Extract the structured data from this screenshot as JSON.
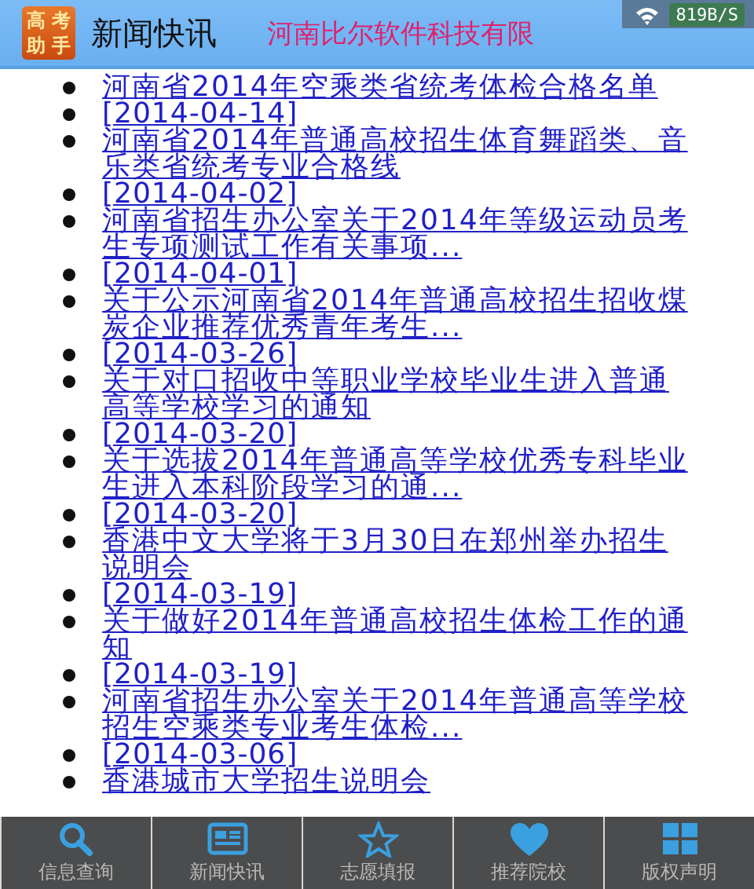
{
  "status_bar": {
    "net_speed": "819B/S"
  },
  "header": {
    "logo_text": "高考助手",
    "title": "新闻快讯",
    "marquee": "河南比尔软件科技有限"
  },
  "news": [
    {
      "kind": "title",
      "text": "河南省2014年空乘类省统考体检合格名单"
    },
    {
      "kind": "date",
      "text": "[2014-04-14]"
    },
    {
      "kind": "title",
      "text": "河南省2014年普通高校招生体育舞蹈类、音乐类省统考专业合格线"
    },
    {
      "kind": "date",
      "text": "[2014-04-02]"
    },
    {
      "kind": "title",
      "text": "河南省招生办公室关于2014年等级运动员考生专项测试工作有关事项..."
    },
    {
      "kind": "date",
      "text": "[2014-04-01]"
    },
    {
      "kind": "title",
      "text": "关于公示河南省2014年普通高校招生招收煤炭企业推荐优秀青年考生..."
    },
    {
      "kind": "date",
      "text": "[2014-03-26]"
    },
    {
      "kind": "title",
      "text": "关于对口招收中等职业学校毕业生进入普通高等学校学习的通知"
    },
    {
      "kind": "date",
      "text": "[2014-03-20]"
    },
    {
      "kind": "title",
      "text": "关于选拔2014年普通高等学校优秀专科毕业生进入本科阶段学习的通..."
    },
    {
      "kind": "date",
      "text": "[2014-03-20]"
    },
    {
      "kind": "title",
      "text": "香港中文大学将于3月30日在郑州举办招生说明会"
    },
    {
      "kind": "date",
      "text": "[2014-03-19]"
    },
    {
      "kind": "title",
      "text": "关于做好2014年普通高校招生体检工作的通知"
    },
    {
      "kind": "date",
      "text": "[2014-03-19]"
    },
    {
      "kind": "title",
      "text": "河南省招生办公室关于2014年普通高等学校招生空乘类专业考生体检..."
    },
    {
      "kind": "date",
      "text": "[2014-03-06]"
    },
    {
      "kind": "title",
      "text": "香港城市大学招生说明会"
    }
  ],
  "tabs": [
    {
      "label": "信息查询"
    },
    {
      "label": "新闻快讯"
    },
    {
      "label": "志愿填报"
    },
    {
      "label": "推荐院校"
    },
    {
      "label": "版权声明"
    }
  ]
}
